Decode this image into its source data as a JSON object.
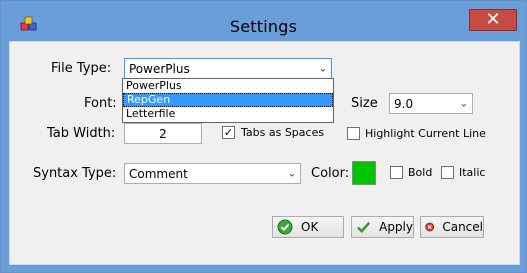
{
  "window": {
    "title": "Settings",
    "close_glyph": "✕"
  },
  "form": {
    "file_type_label": "File Type:",
    "file_type_value": "PowerPlus",
    "file_type_options": [
      "PowerPlus",
      "RepGen",
      "Letterfile"
    ],
    "font_label": "Font:",
    "size_label": "Size",
    "size_value": "9.0",
    "tab_width_label": "Tab Width:",
    "tab_width_value": "2",
    "tabs_as_spaces_label": "Tabs as Spaces",
    "tabs_as_spaces_checked": true,
    "highlight_line_label": "Highlight Current Line",
    "highlight_line_checked": false,
    "syntax_type_label": "Syntax Type:",
    "syntax_type_value": "Comment",
    "color_label": "Color:",
    "color_value": "#00c400",
    "bold_label": "Bold",
    "bold_checked": false,
    "italic_label": "Italic",
    "italic_checked": false
  },
  "buttons": {
    "ok_label": "OK",
    "apply_label": "Apply",
    "cancel_label": "Cancel"
  },
  "colors": {
    "titlebar": "#6a9edb",
    "close": "#c74b42",
    "selection": "#3399ff"
  }
}
